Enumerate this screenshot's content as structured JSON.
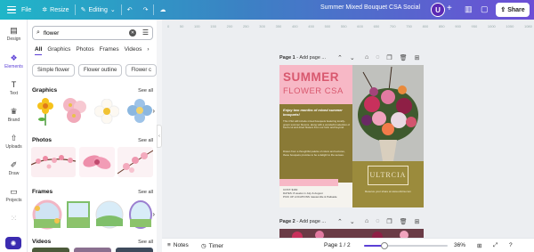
{
  "topbar": {
    "file": "File",
    "resize": "Resize",
    "mode": "Editing",
    "doc_title": "Summer Mixed Bouquet CSA Social",
    "avatar_letter": "U",
    "share": "Share"
  },
  "rail": [
    {
      "label": "Design",
      "icon": "layout-icon"
    },
    {
      "label": "Elements",
      "icon": "elements-icon"
    },
    {
      "label": "Text",
      "icon": "text-icon"
    },
    {
      "label": "Brand",
      "icon": "brand-icon"
    },
    {
      "label": "Uploads",
      "icon": "upload-icon"
    },
    {
      "label": "Draw",
      "icon": "draw-icon"
    },
    {
      "label": "Projects",
      "icon": "folder-icon"
    }
  ],
  "panel": {
    "search_value": "flower",
    "tabs": [
      "All",
      "Graphics",
      "Photos",
      "Frames",
      "Videos"
    ],
    "chips": [
      "Simple flower",
      "Flower outline",
      "Flower c"
    ],
    "sections": {
      "graphics": "Graphics",
      "photos": "Photos",
      "frames": "Frames",
      "videos": "Videos"
    },
    "see_all": "See all"
  },
  "canvas": {
    "page1_label": "Page 1",
    "page2_label": "Page 2",
    "add_title": "- Add page ...",
    "design": {
      "title1": "SUMMER",
      "title2": "FLOWER CSA",
      "lead": "Enjoy two months of mixed summer bouquets!",
      "body1": "This CSA will include mixed bouquets featuring locally-grown summer blooms, along with a wonderful selection of fresh-cut and dried flowers from our farm and beyond.",
      "body2": "Drawn from a thoughtful palette of colors and textures, these bouquets promise to be a delight to the senses.",
      "cost": "COST: $160",
      "dates": "DATES: 8 weeks in July & August",
      "pickup": "PICK UP LOCATIONS: Easterville & Palisade",
      "logo": "ULTRCIA",
      "order": "Reserve your share at www.ultrcia.com"
    }
  },
  "bottombar": {
    "notes": "Notes",
    "timer": "Timer",
    "page_counter": "Page 1 / 2",
    "zoom": "36%",
    "zoom_fraction": 0.36
  },
  "colors": {
    "accent": "#5b3fd6",
    "title_pink": "#d8586e",
    "band_pink": "#f7b8c6",
    "olive": "#8a7a36"
  }
}
